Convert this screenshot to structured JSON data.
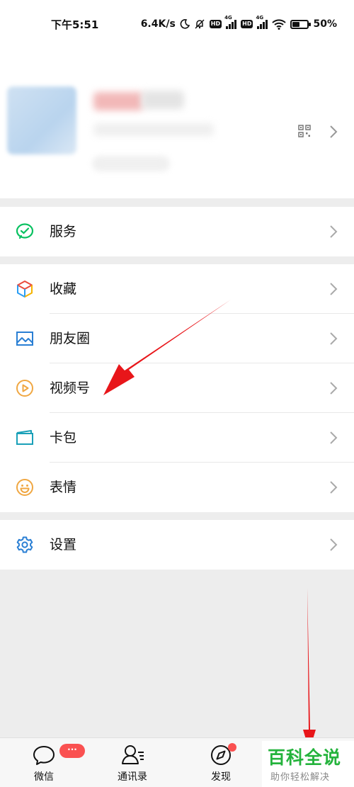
{
  "status_bar": {
    "time": "下午5:51",
    "net_speed": "6.4K/s",
    "hd_label": "HD",
    "net_type": "4G",
    "battery_percent": "50%",
    "battery_level": 0.5
  },
  "menu": {
    "services": {
      "label": "服务",
      "icon": "wechat-pay-icon"
    },
    "favorites": {
      "label": "收藏",
      "icon": "cube-icon"
    },
    "moments": {
      "label": "朋友圈",
      "icon": "picture-icon"
    },
    "channels": {
      "label": "视频号",
      "icon": "play-circle-icon"
    },
    "cards": {
      "label": "卡包",
      "icon": "card-wallet-icon"
    },
    "stickers": {
      "label": "表情",
      "icon": "smiley-icon"
    },
    "settings": {
      "label": "设置",
      "icon": "gear-icon"
    }
  },
  "tabs": [
    {
      "label": "微信",
      "badge": "···"
    },
    {
      "label": "通讯录"
    },
    {
      "label": "发现"
    }
  ],
  "watermark": {
    "title": "百科全说",
    "subtitle": "助你轻松解决"
  },
  "colors": {
    "accent_green": "#07c160",
    "badge_red": "#fa5151",
    "annotation_red": "#e8161a",
    "watermark_green": "#24b33c"
  }
}
